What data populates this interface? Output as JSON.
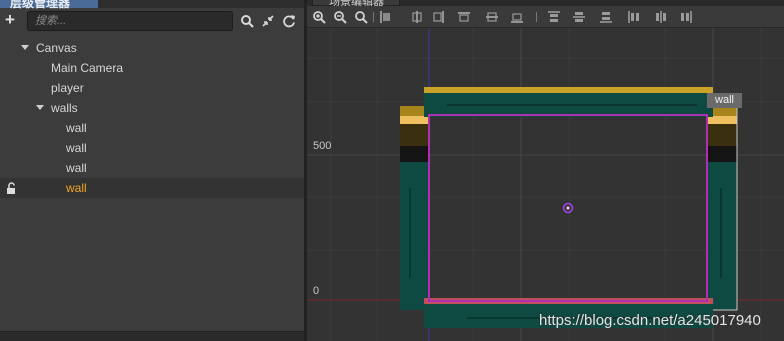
{
  "hierarchy": {
    "tab_title": "层级管理器",
    "search_placeholder": "搜索...",
    "nodes": [
      {
        "label": "Canvas"
      },
      {
        "label": "Main Camera"
      },
      {
        "label": "player"
      },
      {
        "label": "walls"
      },
      {
        "label": "wall"
      },
      {
        "label": "wall"
      },
      {
        "label": "wall"
      },
      {
        "label": "wall"
      }
    ]
  },
  "scene": {
    "tab_title": "场景编辑器",
    "axis_labels": {
      "y_500": "500",
      "y_0": "0"
    },
    "selected_tag": "wall"
  },
  "watermark": "https://blog.csdn.net/a245017940",
  "colors": {
    "selected_text": "#f5a623",
    "selection_outline": "#b02fb0",
    "wall_fill": "#0f4a42",
    "wall_top": "#c9a227"
  },
  "icons": [
    "plus-icon",
    "search-icon",
    "collapse-icon",
    "refresh-icon",
    "lock-icon",
    "zoom-in-icon",
    "zoom-out-icon",
    "zoom-reset-icon"
  ]
}
